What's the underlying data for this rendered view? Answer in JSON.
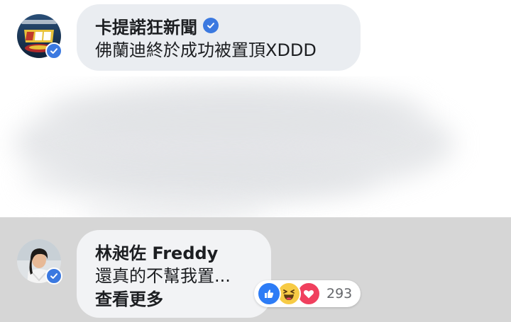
{
  "comments": [
    {
      "author": "卡提諾狂新聞",
      "verified": true,
      "text": "佛蘭迪終於成功被置頂XDDD",
      "avatar": {
        "label": "狂新聞",
        "colors": [
          "#1f3a5a",
          "#e8c23a"
        ]
      }
    },
    {
      "author": "林昶佐 Freddy",
      "verified": true,
      "text": "還真的不幫我置...",
      "see_more": "查看更多",
      "reactions": {
        "types": [
          "like-icon",
          "haha-icon",
          "love-icon"
        ],
        "count": "293"
      }
    }
  ],
  "colors": {
    "verified_blue": "#3b79e0",
    "bubble_top": "#eaedf1",
    "bubble_bottom": "#f2f3f5",
    "bottom_background": "#d6d6d6",
    "like": "#2d7cf6",
    "haha": "#f7cb45",
    "love": "#f0405e"
  }
}
